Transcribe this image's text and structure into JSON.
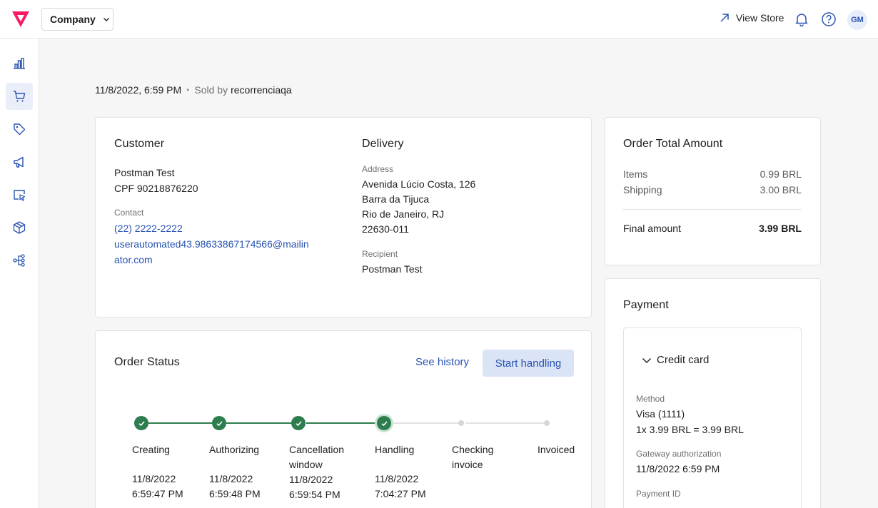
{
  "header": {
    "company_label": "Company",
    "view_store_label": "View Store",
    "avatar_initials": "GM",
    "brand_color": "#f71963"
  },
  "sidebar": {
    "items": [
      {
        "icon": "chart-icon"
      },
      {
        "icon": "cart-icon",
        "active": true
      },
      {
        "icon": "tag-icon"
      },
      {
        "icon": "megaphone-icon"
      },
      {
        "icon": "cursor-window-icon"
      },
      {
        "icon": "box-icon"
      },
      {
        "icon": "flow-icon"
      }
    ]
  },
  "order_meta": {
    "date": "11/8/2022, 6:59 PM",
    "separator": "•",
    "sold_by_label": "Sold by",
    "seller": "recorrenciaqa"
  },
  "customer": {
    "title": "Customer",
    "name": "Postman Test",
    "document": "CPF 90218876220",
    "contact_label": "Contact",
    "phone": "(22) 2222-2222",
    "email_line1": "userautomated43.98633867174566@mailin",
    "email_line2": "ator.com"
  },
  "delivery": {
    "title": "Delivery",
    "address_label": "Address",
    "address_lines": [
      "Avenida Lúcio Costa, 126",
      "Barra da Tijuca",
      "Rio de Janeiro, RJ",
      "22630-011"
    ],
    "recipient_label": "Recipient",
    "recipient": "Postman Test"
  },
  "totals": {
    "title": "Order Total Amount",
    "items_label": "Items",
    "items_value": "0.99 BRL",
    "shipping_label": "Shipping",
    "shipping_value": "3.00 BRL",
    "final_label": "Final amount",
    "final_value": "3.99 BRL"
  },
  "status": {
    "title": "Order Status",
    "see_history": "See history",
    "start_handling": "Start handling",
    "steps": [
      {
        "label": "Creating",
        "date": "11/8/2022",
        "time": "6:59:47 PM",
        "done": true
      },
      {
        "label": "Authorizing",
        "date": "11/8/2022",
        "time": "6:59:48 PM",
        "done": true
      },
      {
        "label1": "Cancellation",
        "label2": "window",
        "date": "11/8/2022",
        "time": "6:59:54 PM",
        "done": true
      },
      {
        "label": "Handling",
        "date": "11/8/2022",
        "time": "7:04:27 PM",
        "done": true,
        "current": true
      },
      {
        "label1": "Checking",
        "label2": "invoice",
        "done": false
      },
      {
        "label": "Invoiced",
        "done": false
      }
    ],
    "done_color": "#2e7d4f"
  },
  "payment": {
    "title": "Payment",
    "method_group": "Credit card",
    "method_label": "Method",
    "method_value": "Visa (1111)",
    "installments": "1x 3.99 BRL = 3.99 BRL",
    "gateway_label": "Gateway authorization",
    "gateway_value": "11/8/2022 6:59 PM",
    "payment_id_label": "Payment ID"
  }
}
